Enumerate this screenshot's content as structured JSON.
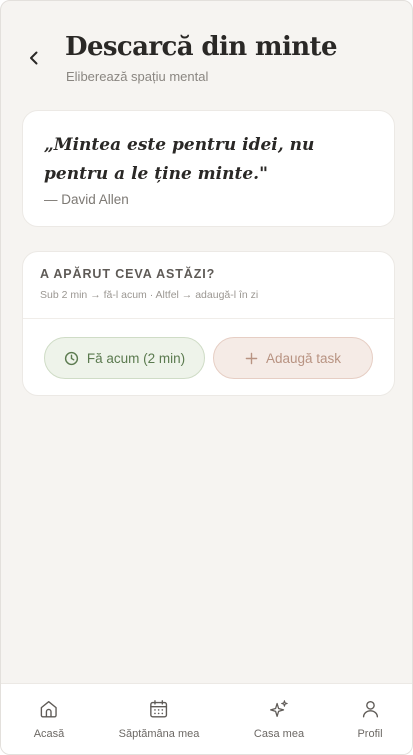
{
  "header": {
    "title": "Descarcă din minte",
    "subtitle": "Eliberează spațiu mental"
  },
  "quote": {
    "text": "„Mintea este pentru idei, nu pentru a le ține minte.\"",
    "author": "— David Allen"
  },
  "capture": {
    "heading": "A APĂRUT CEVA ASTĂZI?",
    "hint": "Sub 2 min → fă-l acum · Altfel → adaugă-l în zi",
    "do_now_label": "Fă acum (2 min)",
    "add_task_label": "Adaugă task"
  },
  "nav": {
    "items": [
      {
        "label": "Acasă",
        "icon": "home-icon"
      },
      {
        "label": "Săptămâna mea",
        "icon": "calendar-icon"
      },
      {
        "label": "Casa mea",
        "icon": "sparkles-icon"
      },
      {
        "label": "Profil",
        "icon": "user-icon"
      }
    ]
  },
  "colors": {
    "background": "#f6f4f1",
    "do_now_accent": "#5b7a4f",
    "add_task_accent": "#b89382"
  }
}
